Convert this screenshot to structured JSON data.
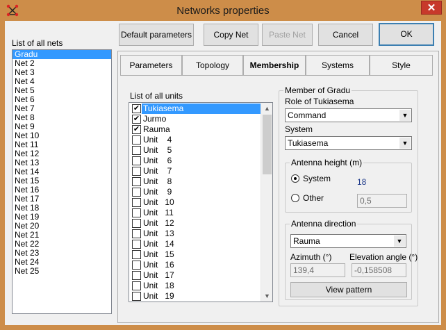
{
  "window": {
    "title": "Networks properties",
    "close_label": "✕"
  },
  "nets": {
    "label": "List of all nets",
    "items": [
      "Gradu",
      "Net  2",
      "Net  3",
      "Net  4",
      "Net  5",
      "Net  6",
      "Net  7",
      "Net  8",
      "Net  9",
      "Net 10",
      "Net 11",
      "Net 12",
      "Net 13",
      "Net 14",
      "Net 15",
      "Net 16",
      "Net 17",
      "Net 18",
      "Net 19",
      "Net 20",
      "Net 21",
      "Net 22",
      "Net 23",
      "Net 24",
      "Net 25"
    ],
    "selected_index": 0
  },
  "buttons": {
    "default_params": "Default parameters",
    "copy_net": "Copy Net",
    "paste_net": "Paste Net",
    "cancel": "Cancel",
    "ok": "OK"
  },
  "tabs": [
    "Parameters",
    "Topology",
    "Membership",
    "Systems",
    "Style"
  ],
  "active_tab": "Membership",
  "units": {
    "label": "List of all units",
    "items": [
      {
        "name": "Tukiasema",
        "checked": true
      },
      {
        "name": "Jurmo",
        "checked": true
      },
      {
        "name": "Rauma",
        "checked": true
      },
      {
        "name": "Unit    4",
        "checked": false
      },
      {
        "name": "Unit    5",
        "checked": false
      },
      {
        "name": "Unit    6",
        "checked": false
      },
      {
        "name": "Unit    7",
        "checked": false
      },
      {
        "name": "Unit    8",
        "checked": false
      },
      {
        "name": "Unit    9",
        "checked": false
      },
      {
        "name": "Unit   10",
        "checked": false
      },
      {
        "name": "Unit   11",
        "checked": false
      },
      {
        "name": "Unit   12",
        "checked": false
      },
      {
        "name": "Unit   13",
        "checked": false
      },
      {
        "name": "Unit   14",
        "checked": false
      },
      {
        "name": "Unit   15",
        "checked": false
      },
      {
        "name": "Unit   16",
        "checked": false
      },
      {
        "name": "Unit   17",
        "checked": false
      },
      {
        "name": "Unit   18",
        "checked": false
      },
      {
        "name": "Unit   19",
        "checked": false
      }
    ],
    "selected_index": 0
  },
  "member": {
    "group_title": "Member of Gradu",
    "role_label": "Role of Tukiasema",
    "role_value": "Command",
    "system_label": "System",
    "system_value": "Tukiasema",
    "antenna_height": {
      "title": "Antenna height (m)",
      "system_label": "System",
      "system_value": "18",
      "other_label": "Other",
      "other_value": "0,5",
      "selected": "System"
    },
    "antenna_direction": {
      "title": "Antenna direction",
      "target_value": "Rauma",
      "azimuth_label": "Azimuth (°)",
      "azimuth_value": "139,4",
      "elevation_label": "Elevation angle (°)",
      "elevation_value": "-0,158508",
      "view_pattern": "View pattern"
    }
  },
  "colors": {
    "title_bar": "#cd8d49",
    "selection": "#3399ff",
    "close_button": "#c7392b",
    "value_text": "#1f3a8a"
  }
}
